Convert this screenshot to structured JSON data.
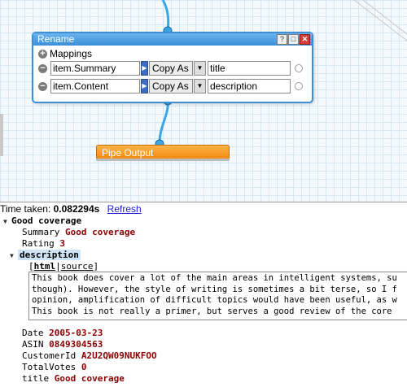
{
  "module": {
    "title": "Rename",
    "window_buttons": [
      "?",
      "□",
      "✕"
    ],
    "mappings_label": "Mappings",
    "rows": [
      {
        "source": "item.Summary",
        "op": "Copy As",
        "target": "title"
      },
      {
        "source": "item.Content",
        "op": "Copy As",
        "target": "description"
      }
    ]
  },
  "output_module": {
    "title": "Pipe Output"
  },
  "debug": {
    "time_label": "Time taken:",
    "time_value": "0.082294s",
    "refresh_label": "Refresh",
    "item_title": "Good coverage",
    "summary_key": "Summary",
    "summary_value": "Good coverage",
    "rating_key": "Rating",
    "rating_value": "3",
    "description_key": "description",
    "html_label": "html",
    "source_label": "source",
    "description_lines": [
      "This book does cover a lot of the main areas in intelligent systems, su",
      "though). However, the style of writing is sometimes a bit terse, so I f",
      "opinion, amplification of difficult topics would have been useful, as w",
      "This book is not really a primer, but serves a good review of the core"
    ],
    "date_key": "Date",
    "date_value": "2005-03-23",
    "asin_key": "ASIN",
    "asin_value": "0849304563",
    "customer_key": "CustomerId",
    "customer_value": "A2U2QW09NUKFOO",
    "votes_key": "TotalVotes",
    "votes_value": "0",
    "title_key": "title",
    "title_value": "Good coverage"
  },
  "colors": {
    "module_header": "#3a8fd8",
    "output_module": "#f28a12",
    "value_text": "#8b0000",
    "link": "#1a1ad6"
  }
}
